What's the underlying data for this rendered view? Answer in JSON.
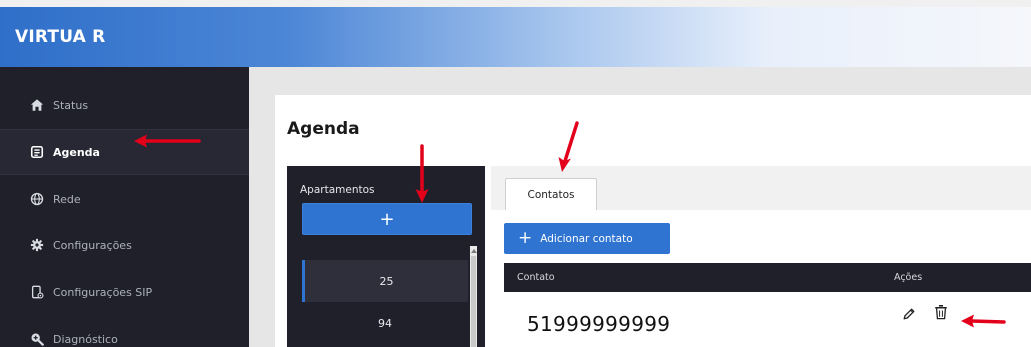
{
  "app": {
    "title": "VIRTUA R"
  },
  "sidebar": {
    "items": [
      {
        "label": "Status",
        "icon": "home-icon",
        "active": false
      },
      {
        "label": "Agenda",
        "icon": "agenda-icon",
        "active": true
      },
      {
        "label": "Rede",
        "icon": "globe-icon",
        "active": false
      },
      {
        "label": "Configurações",
        "icon": "gear-icon",
        "active": false
      },
      {
        "label": "Configurações SIP",
        "icon": "phone-settings-icon",
        "active": false
      },
      {
        "label": "Diagnóstico",
        "icon": "diagnostic-search-icon",
        "active": false
      }
    ]
  },
  "main": {
    "page_title": "Agenda",
    "apartments": {
      "title": "Apartamentos",
      "add_label": "+",
      "items": [
        "25",
        "94"
      ],
      "selected": "25"
    },
    "contacts": {
      "tab_label": "Contatos",
      "add_button_label": "Adicionar contato",
      "add_button_icon": "+",
      "columns": {
        "contact": "Contato",
        "actions": "Ações"
      },
      "rows": [
        {
          "contact": "51999999999"
        }
      ]
    }
  },
  "colors": {
    "accent": "#2f74d1",
    "sidebar_bg": "#1f2029",
    "annotation": "#e3001b"
  }
}
